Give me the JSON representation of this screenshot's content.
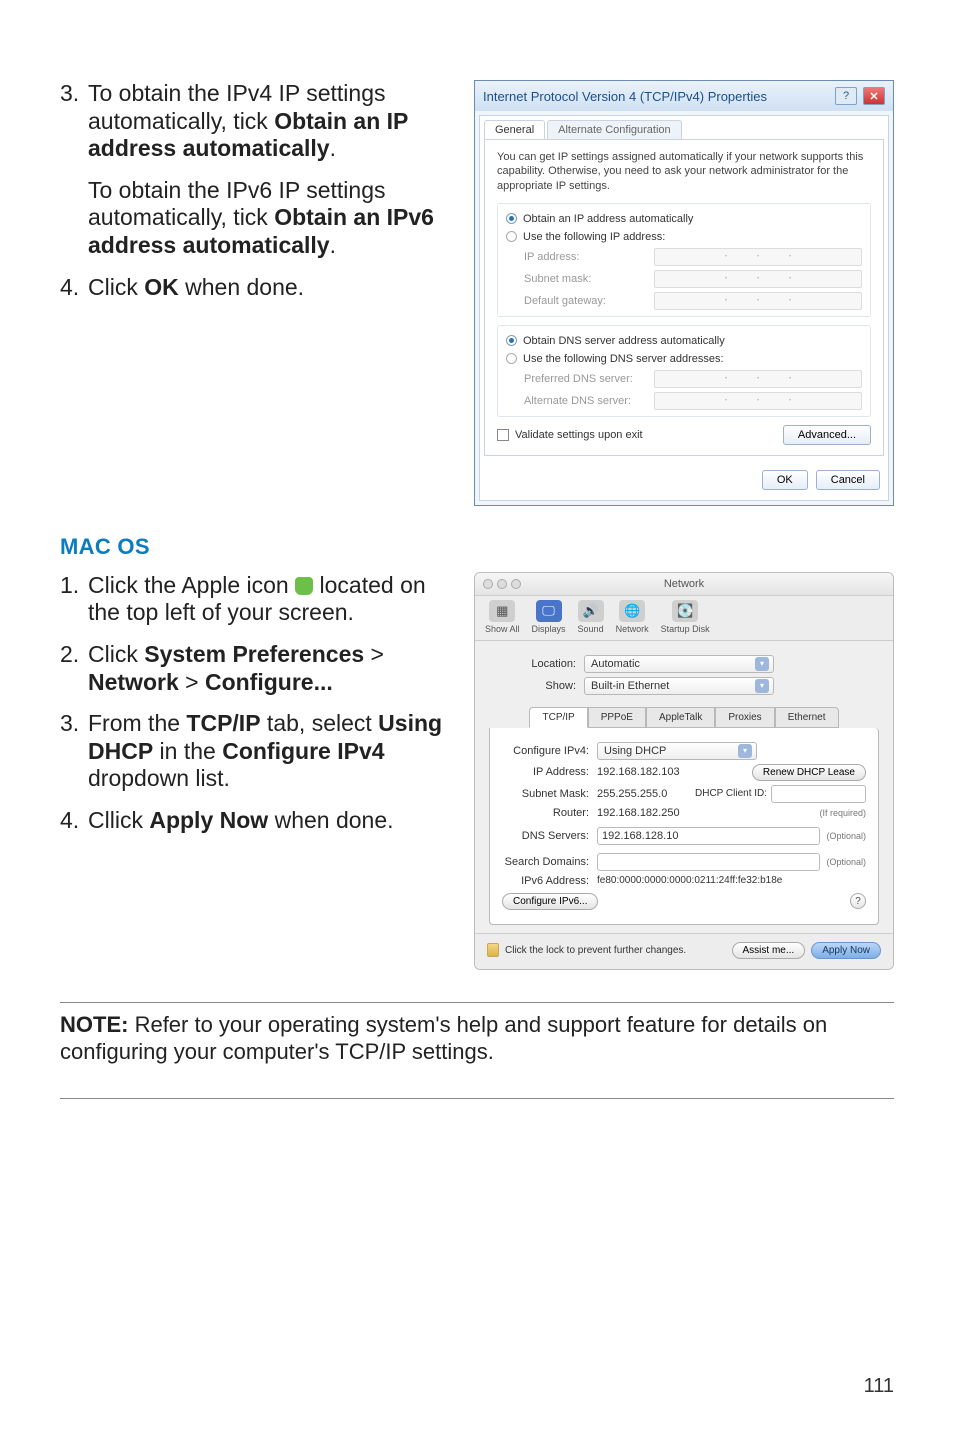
{
  "steps_top": {
    "s3_num": "3.",
    "s3_a": "To obtain the IPv4 IP settings automatically, tick ",
    "s3_b": "Obtain an IP address automatically",
    "s3_c": ".",
    "s3_sub_a": "To obtain the IPv6 IP settings automatically, tick ",
    "s3_sub_b": "Obtain an IPv6 address automatically",
    "s3_sub_c": ".",
    "s4_num": "4.",
    "s4_a": "Click ",
    "s4_b": "OK",
    "s4_c": " when done."
  },
  "mac_heading": "MAC OS",
  "mac_steps": {
    "s1_num": "1.",
    "s1_a": "Click the Apple icon ",
    "s1_b": " located on the top left of your screen.",
    "s2_num": "2.",
    "s2_a": "Click ",
    "s2_b": "System Preferences",
    "s2_c": " > ",
    "s2_d": "Network",
    "s2_e": " > ",
    "s2_f": "Configure...",
    "s3_num": "3.",
    "s3_a": "From the ",
    "s3_b": "TCP/IP",
    "s3_c": " tab, select ",
    "s3_d": "Using DHCP",
    "s3_e": " in the ",
    "s3_f": "Configure IPv4",
    "s3_g": " dropdown list.",
    "s4_num": "4.",
    "s4_a": "Cllick ",
    "s4_b": "Apply Now",
    "s4_c": " when done."
  },
  "note": {
    "label": "NOTE:",
    "text": " Refer to your operating system's help and support feature for details on configuring your computer's TCP/IP settings."
  },
  "page_number": "111",
  "win": {
    "title": "Internet Protocol Version 4 (TCP/IPv4) Properties",
    "help": "?",
    "close": "✕",
    "tab_general": "General",
    "tab_alt": "Alternate Configuration",
    "desc": "You can get IP settings assigned automatically if your network supports this capability. Otherwise, you need to ask your network administrator for the appropriate IP settings.",
    "r_ip_auto": "Obtain an IP address automatically",
    "r_ip_use": "Use the following IP address:",
    "f_ip": "IP address:",
    "f_mask": "Subnet mask:",
    "f_gw": "Default gateway:",
    "r_dns_auto": "Obtain DNS server address automatically",
    "r_dns_use": "Use the following DNS server addresses:",
    "f_pdns": "Preferred DNS server:",
    "f_adns": "Alternate DNS server:",
    "chk_validate": "Validate settings upon exit",
    "btn_adv": "Advanced...",
    "btn_ok": "OK",
    "btn_cancel": "Cancel"
  },
  "mac": {
    "window_title": "Network",
    "tool_showall": "Show All",
    "tool_displays": "Displays",
    "tool_sound": "Sound",
    "tool_network": "Network",
    "tool_startup": "Startup Disk",
    "lbl_location": "Location:",
    "val_location": "Automatic",
    "lbl_show": "Show:",
    "val_show": "Built-in Ethernet",
    "tab_tcpip": "TCP/IP",
    "tab_pppoe": "PPPoE",
    "tab_apple": "AppleTalk",
    "tab_proxies": "Proxies",
    "tab_eth": "Ethernet",
    "lbl_cfg4": "Configure IPv4:",
    "val_cfg4": "Using DHCP",
    "lbl_ip": "IP Address:",
    "val_ip": "192.168.182.103",
    "lbl_sm": "Subnet Mask:",
    "val_sm": "255.255.255.0",
    "lbl_router": "Router:",
    "val_router": "192.168.182.250",
    "lbl_dns": "DNS Servers:",
    "val_dns": "192.168.128.10",
    "lbl_search": "Search Domains:",
    "lbl_ipv6": "IPv6 Address:",
    "val_ipv6": "fe80:0000:0000:0000:0211:24ff:fe32:b18e",
    "btn_renew": "Renew DHCP Lease",
    "lbl_dhcpid": "DHCP Client ID:",
    "note_ifreq": "(If required)",
    "note_opt": "(Optional)",
    "btn_cfg6": "Configure IPv6...",
    "help": "?",
    "lock_text": "Click the lock to prevent further changes.",
    "btn_assist": "Assist me...",
    "btn_apply": "Apply Now"
  }
}
